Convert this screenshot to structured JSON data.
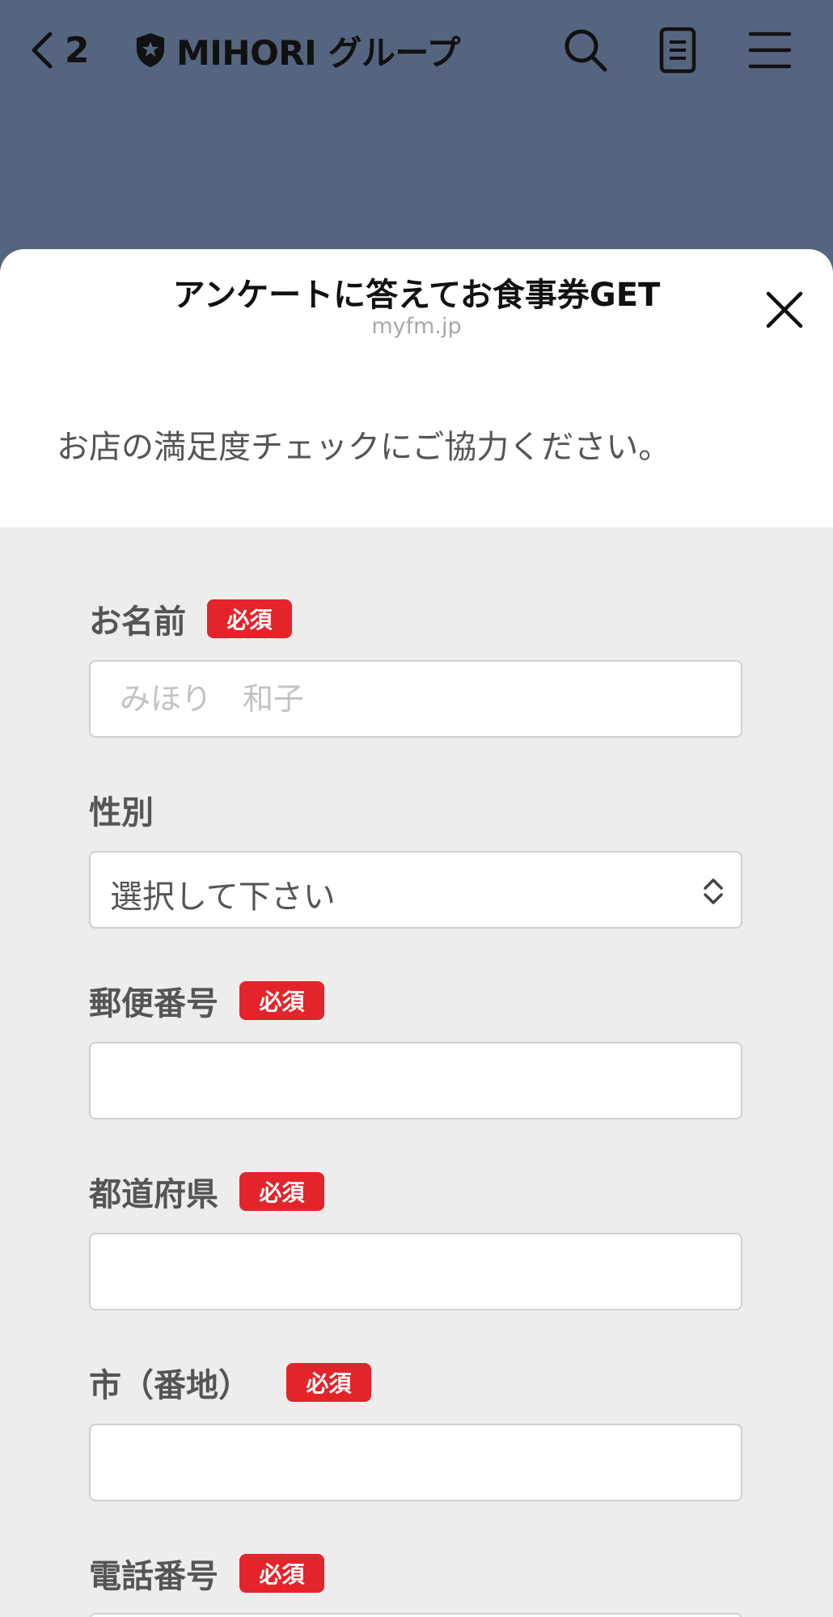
{
  "header": {
    "back_count": "2",
    "account_name": "MIHORI グループ"
  },
  "sheet": {
    "title": "アンケートに答えてお食事券GET",
    "domain": "myfm.jp",
    "intro": "お店の満足度チェックにご協力ください。"
  },
  "form": {
    "required_label": "必須",
    "name": {
      "label": "お名前",
      "placeholder": "みほり　和子",
      "value": ""
    },
    "gender": {
      "label": "性別",
      "selected": "選択して下さい"
    },
    "postal": {
      "label": "郵便番号",
      "value": ""
    },
    "prefecture": {
      "label": "都道府県",
      "value": ""
    },
    "city": {
      "label": "市（番地）",
      "value": ""
    },
    "phone": {
      "label": "電話番号"
    }
  },
  "colors": {
    "header_bg": "#55657f",
    "required_badge": "#e3242b",
    "form_bg": "#ededed"
  },
  "icons": [
    "chevron-left-icon",
    "shield-star-icon",
    "search-icon",
    "note-icon",
    "menu-icon",
    "close-icon",
    "select-arrows-icon"
  ]
}
